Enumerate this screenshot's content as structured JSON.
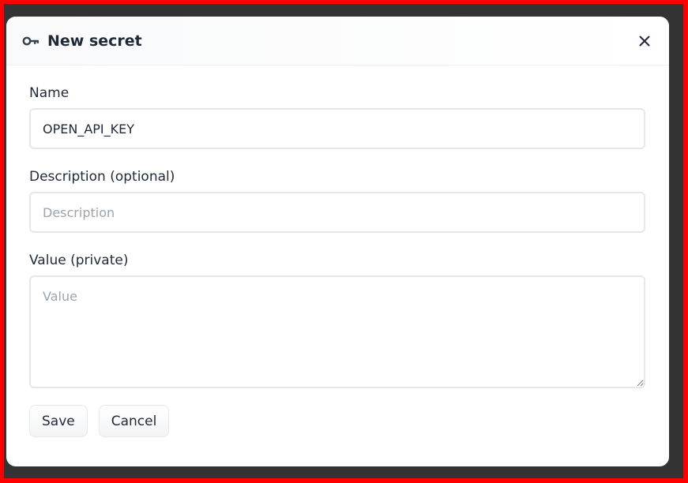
{
  "dialog": {
    "title": "New secret",
    "icon": "key-icon",
    "close_icon": "close-icon"
  },
  "form": {
    "name": {
      "label": "Name",
      "value": "OPEN_API_KEY",
      "placeholder": ""
    },
    "description": {
      "label": "Description (optional)",
      "value": "",
      "placeholder": "Description"
    },
    "value": {
      "label": "Value (private)",
      "value": "",
      "placeholder": "Value"
    }
  },
  "actions": {
    "save_label": "Save",
    "cancel_label": "Cancel"
  },
  "colors": {
    "frame": "#ff0000",
    "backdrop": "#333333",
    "text": "#1f2937",
    "placeholder": "#9ca3af",
    "border": "#e5e7eb"
  }
}
